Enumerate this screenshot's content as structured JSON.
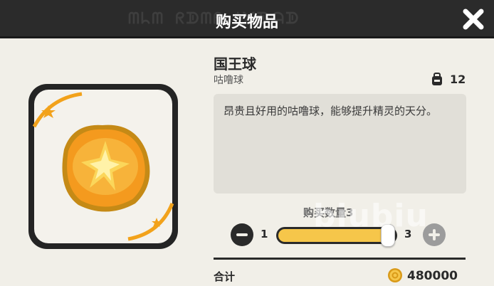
{
  "header": {
    "ghost_text": "ᗰᖺᗰ ᖇᗫᗰᖇ ᐩ᙭ᗫᗩᗫ",
    "title": "购买物品",
    "close_icon": "close-icon"
  },
  "item": {
    "name": "国王球",
    "category": "咕噜球",
    "owned_count": "12",
    "owned_icon": "backpack-icon",
    "description": "昂贵且好用的咕噜球，能够提升精灵的天分。",
    "image_icon": "king-ball-icon"
  },
  "quantity": {
    "label": "购买数量3",
    "min": "1",
    "max": "3",
    "current": 3,
    "min_value": 1,
    "max_value": 3,
    "minus_icon": "minus-icon",
    "plus_icon": "plus-icon"
  },
  "total": {
    "label": "合计",
    "value": "480000",
    "currency_icon": "coin-icon"
  },
  "watermark": "biubiu",
  "colors": {
    "header_bg": "#2b2b2b",
    "panel_bg": "#f1efe8",
    "accent_yellow": "#f6c64a",
    "accent_orange": "#f2a21b",
    "dark": "#2a2a2a"
  }
}
